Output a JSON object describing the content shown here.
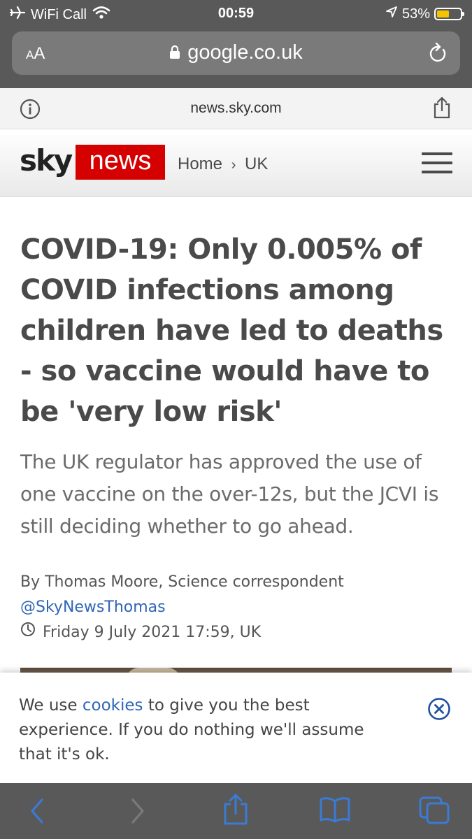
{
  "status_bar": {
    "carrier": "WiFi Call",
    "time": "00:59",
    "battery_percent": "53%",
    "battery_level": 0.53
  },
  "browser": {
    "text_size_label": "AA",
    "url": "google.co.uk",
    "site_host": "news.sky.com"
  },
  "header": {
    "logo_sky": "sky",
    "logo_news": "news",
    "breadcrumb_home": "Home",
    "breadcrumb_separator": "›",
    "breadcrumb_section": "UK"
  },
  "article": {
    "headline": "COVID-19: Only 0.005% of COVID infections among children have led to deaths - so vaccine would have to be 'very low risk'",
    "standfirst": "The UK regulator has approved the use of one vaccine on the over-12s, but the JCVI is still deciding whether to go ahead.",
    "byline": "By Thomas Moore, Science correspondent",
    "twitter_handle": "@SkyNewsThomas",
    "date": "Friday 9 July 2021 17:59, UK"
  },
  "cookie_banner": {
    "text_before": "We use ",
    "link_text": "cookies",
    "text_after": " to give you the best experience. If you do nothing we'll assume that it's ok."
  },
  "colors": {
    "brand_red": "#d50000",
    "link_blue": "#2f66b7",
    "toolbar_icon_blue": "#3a7bd5",
    "chrome_gray": "#595959"
  }
}
